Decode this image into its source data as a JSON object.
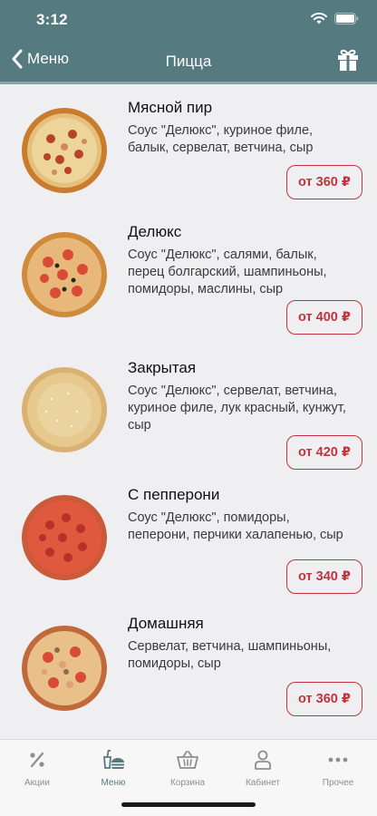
{
  "status_bar": {
    "time": "3:12",
    "icons": [
      "wifi-icon",
      "battery-icon"
    ]
  },
  "nav": {
    "back_label": "Меню",
    "title": "Пицца",
    "right_icon": "gift-icon"
  },
  "colors": {
    "header": "#557a7f",
    "accent": "#c0343d",
    "background": "#efeff1",
    "tab_active": "#557a7f",
    "tab_inactive": "#8d8d92"
  },
  "products": [
    {
      "name": "Мясной пир",
      "desc": [
        "Соус \"Делюкс\", куриное филе,",
        "балык, сервелат, ветчина, сыр"
      ],
      "price": "от 360 ₽"
    },
    {
      "name": "Делюкс",
      "desc": [
        "Соус \"Делюкс\", салями, балык,",
        "перец болгарский, шампиньоны,",
        "помидоры, маслины, сыр"
      ],
      "price": "от 400 ₽"
    },
    {
      "name": "Закрытая",
      "desc": [
        "Соус \"Делюкс\", сервелат, ветчина,",
        "куриное филе, лук красный, кунжут,",
        "сыр"
      ],
      "price": "от 420 ₽"
    },
    {
      "name": "С пепперони",
      "desc": [
        "Соус \"Делюкс\", помидоры,",
        "пеперони, перчики халапенью, сыр"
      ],
      "price": "от 340 ₽"
    },
    {
      "name": "Домашняя",
      "desc": [
        "Сервелат, ветчина, шампиньоны,",
        "помидоры, сыр"
      ],
      "price": "от 360 ₽"
    }
  ],
  "tabs": [
    {
      "label": "Акции",
      "icon": "percent-icon",
      "active": false
    },
    {
      "label": "Меню",
      "icon": "menu-food-icon",
      "active": true
    },
    {
      "label": "Корзина",
      "icon": "basket-icon",
      "active": false
    },
    {
      "label": "Кабинет",
      "icon": "user-icon",
      "active": false
    },
    {
      "label": "Прочее",
      "icon": "more-icon",
      "active": false
    }
  ]
}
